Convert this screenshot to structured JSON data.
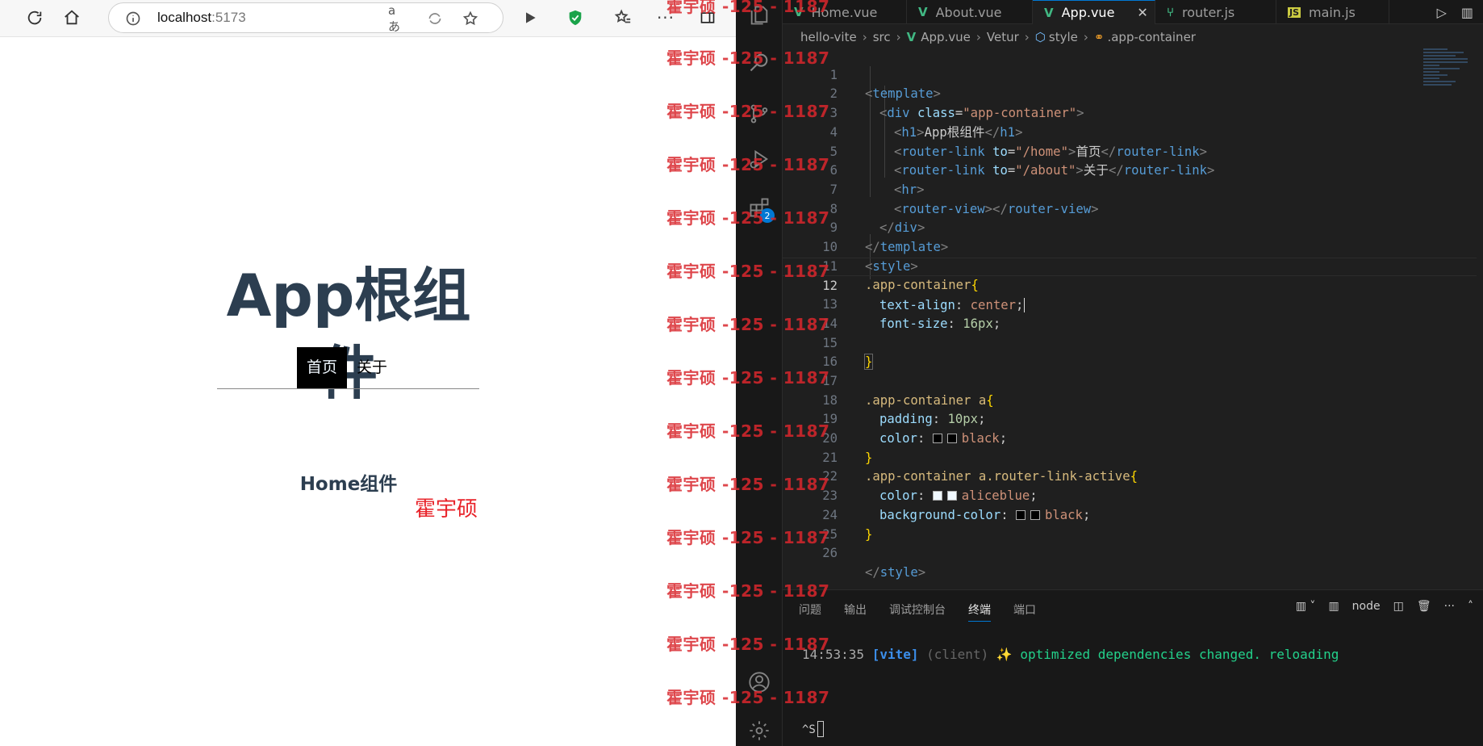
{
  "browser": {
    "address": "localhost",
    "port": ":5173",
    "page": {
      "title": "App根组件",
      "nav": [
        {
          "label": "首页",
          "active": true
        },
        {
          "label": "关于",
          "active": false
        }
      ],
      "home_view": "Home组件",
      "signature": "霍宇硕"
    }
  },
  "watermark": "霍宇硕 -125 - 1187",
  "editor": {
    "tabs": [
      {
        "label": "Home.vue",
        "icon": "vue-icon",
        "active": false
      },
      {
        "label": "About.vue",
        "icon": "vue-icon",
        "active": false
      },
      {
        "label": "App.vue",
        "icon": "vue-icon",
        "active": true
      },
      {
        "label": "router.js",
        "icon": "router-icon",
        "active": false
      },
      {
        "label": "main.js",
        "icon": "js-icon",
        "active": false
      }
    ],
    "activity_badge": "2",
    "breadcrumb": [
      "hello-vite",
      "src",
      "App.vue",
      "Vetur",
      "style",
      ".app-container"
    ],
    "current_line": 12,
    "lines": [
      "1",
      "2",
      "3",
      "4",
      "5",
      "6",
      "7",
      "8",
      "9",
      "10",
      "11",
      "12",
      "13",
      "14",
      "15",
      "16",
      "17",
      "18",
      "19",
      "20",
      "21",
      "22",
      "23",
      "24",
      "25",
      "26"
    ],
    "code": {
      "l1_tag": "template",
      "l2_tag": "div",
      "l2_attr": "class",
      "l2_val": "\"app-container\"",
      "l3_tag": "h1",
      "l3_text": "App根组件",
      "l4_tag": "router-link",
      "l4_attr": "to",
      "l4_val": "\"/home\"",
      "l4_text": "首页",
      "l5_tag": "router-link",
      "l5_attr": "to",
      "l5_val": "\"/about\"",
      "l5_text": "关于",
      "l6_tag": "hr",
      "l7_tag": "router-view",
      "l8_tag": "div",
      "l9_tag": "template",
      "l10_tag": "style",
      "l11_sel": ".app-container",
      "l12_prop": "text-align",
      "l12_val": "center",
      "l13_prop": "font-size",
      "l13_val": "16px",
      "l17_sel": ".app-container a",
      "l18_prop": "padding",
      "l18_val": "10px",
      "l19_prop": "color",
      "l19_val": "black",
      "l21_sel": ".app-container a.router-link-active",
      "l22_prop": "color",
      "l22_val": "aliceblue",
      "l23_prop": "background-color",
      "l23_val": "black",
      "l26_tag": "style"
    },
    "panel": {
      "tabs": [
        {
          "label": "问题",
          "active": false
        },
        {
          "label": "输出",
          "active": false
        },
        {
          "label": "调试控制台",
          "active": false
        },
        {
          "label": "终端",
          "active": true
        },
        {
          "label": "端口",
          "active": false
        }
      ],
      "terminal_name": "node",
      "terminal": {
        "time": "14:53:35",
        "vite": "[vite]",
        "client": "(client)",
        "message": "✨ optimized dependencies changed. reloading"
      },
      "prompt": "^S"
    }
  },
  "colors": {
    "accent": "#0078d4",
    "editor_bg": "#1f1f1f",
    "title_color": "#2c3e50",
    "watermark": "#d9272d"
  }
}
